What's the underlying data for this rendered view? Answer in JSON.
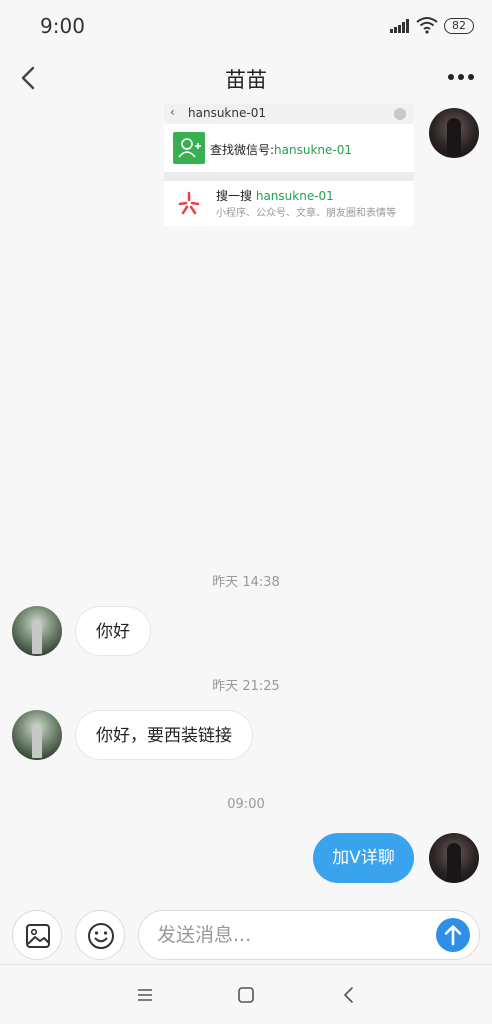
{
  "status_bar": {
    "time": "9:00",
    "battery": "82",
    "icons": [
      "signal-icon",
      "wifi-icon",
      "battery-icon"
    ]
  },
  "header": {
    "title": "苗苗",
    "back_icon": "chevron-left-icon",
    "more_icon": "more-dots-icon"
  },
  "image_message": {
    "search_query": "hansukne-01",
    "find_label": "查找微信号:",
    "find_id": "hansukne-01",
    "search_label": "搜一搜",
    "search_term": "hansukne-01",
    "search_sub": "小程序、公众号、文章、朋友圈和表情等"
  },
  "messages": [
    {
      "timestamp": "昨天 14:38",
      "text": "你好",
      "direction": "in"
    },
    {
      "timestamp": "昨天 21:25",
      "text": "你好，要西装链接",
      "direction": "in"
    },
    {
      "timestamp": "09:00",
      "text": "加V详聊",
      "direction": "out"
    }
  ],
  "input_bar": {
    "placeholder": "发送消息...",
    "image_icon": "image-icon",
    "emoji_icon": "emoji-icon",
    "send_icon": "arrow-up-icon"
  },
  "colors": {
    "accent_blue": "#3aa3ee",
    "wechat_green": "#20a350"
  }
}
